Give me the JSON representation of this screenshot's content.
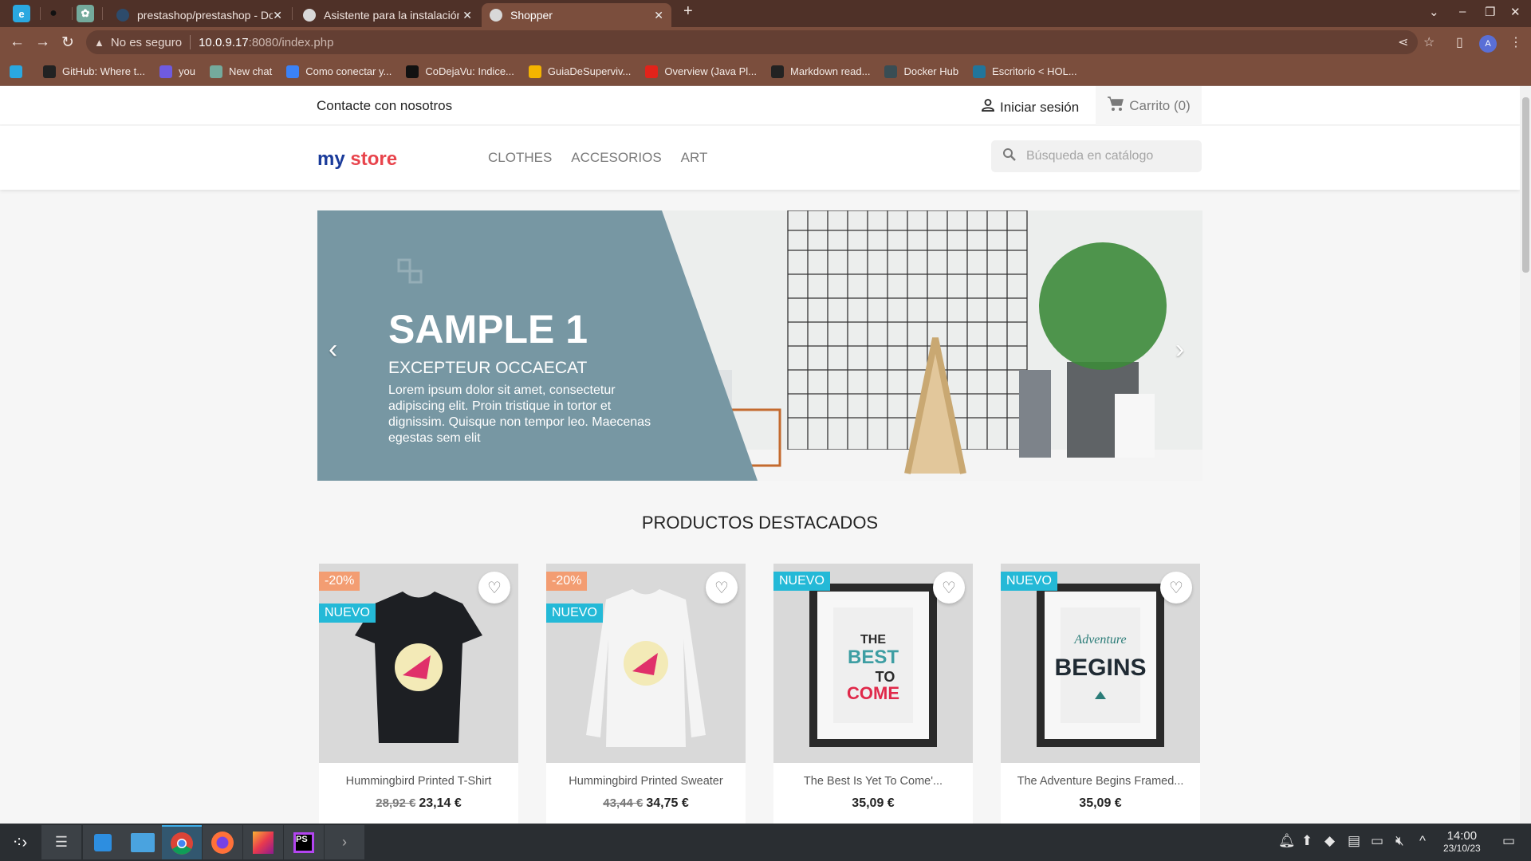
{
  "browser": {
    "pinned_tabs": [
      "edge-like-app-icon",
      "github-icon",
      "chatgpt-icon"
    ],
    "tabs": [
      {
        "title": "prestashop/prestashop - Do",
        "active": false
      },
      {
        "title": "Asistente para la instalación",
        "active": false
      },
      {
        "title": "Shopper",
        "active": true
      }
    ],
    "new_tab": "+",
    "window_controls": {
      "tab_search": "⌄",
      "minimize": "–",
      "restore": "❐",
      "close": "✕"
    },
    "security_label": "No es seguro",
    "url_host": "10.0.9.17",
    "url_rest": ":8080/index.php",
    "profile_initial": "A",
    "bookmarks": [
      {
        "label": "",
        "icon": "#2aa8e0"
      },
      {
        "label": "GitHub: Where t...",
        "icon": "#222"
      },
      {
        "label": "you",
        "icon": "#6f5be0"
      },
      {
        "label": "New chat",
        "icon": "#74aa9c"
      },
      {
        "label": "Como conectar y...",
        "icon": "#3b82f6"
      },
      {
        "label": "CoDejaVu: Indice...",
        "icon": "#111"
      },
      {
        "label": "GuiaDeSuperviv...",
        "icon": "#f4b400"
      },
      {
        "label": "Overview (Java Pl...",
        "icon": "#e2231a"
      },
      {
        "label": "Markdown read...",
        "icon": "#222"
      },
      {
        "label": "Docker Hub",
        "icon": "#394d54"
      },
      {
        "label": "Escritorio < HOL...",
        "icon": "#21759b"
      }
    ]
  },
  "store": {
    "contact": "Contacte con nosotros",
    "signin": "Iniciar sesión",
    "cart": "Carrito (0)",
    "logo": {
      "m": "my",
      "s": "store"
    },
    "menu": [
      "CLOTHES",
      "ACCESORIOS",
      "ART"
    ],
    "search_placeholder": "Búsqueda en catálogo",
    "slider": {
      "title": "SAMPLE 1",
      "subtitle": "EXCEPTEUR OCCAECAT",
      "text": "Lorem ipsum dolor sit amet, consectetur adipiscing elit. Proin tristique in tortor et dignissim. Quisque non tempor leo. Maecenas egestas sem elit",
      "prev": "‹",
      "next": "›",
      "panel_color": "#7797a3"
    },
    "section_title": "PRODUCTOS DESTACADOS",
    "products": [
      {
        "name": "Hummingbird Printed T-Shirt",
        "old_price": "28,92 €",
        "price": "23,14 €",
        "discount": "-20%",
        "new": "NUEVO"
      },
      {
        "name": "Hummingbird Printed Sweater",
        "old_price": "43,44 €",
        "price": "34,75 €",
        "discount": "-20%",
        "new": "NUEVO"
      },
      {
        "name": "The Best Is Yet To Come'...",
        "old_price": "",
        "price": "35,09 €",
        "discount": "",
        "new": "NUEVO"
      },
      {
        "name": "The Adventure Begins Framed...",
        "old_price": "",
        "price": "35,09 €",
        "discount": "",
        "new": "NUEVO"
      }
    ],
    "colors": {
      "discount": "#f39d72",
      "new": "#24b9d7"
    }
  },
  "taskbar": {
    "apps": [
      "app-launcher-icon",
      "system-settings-icon",
      "discover-store-icon",
      "file-manager-icon",
      "chrome-icon",
      "firefox-icon",
      "toolbox-icon",
      "phpstorm-icon",
      "terminal-icon"
    ],
    "time": "14:00",
    "date": "23/10/23"
  }
}
